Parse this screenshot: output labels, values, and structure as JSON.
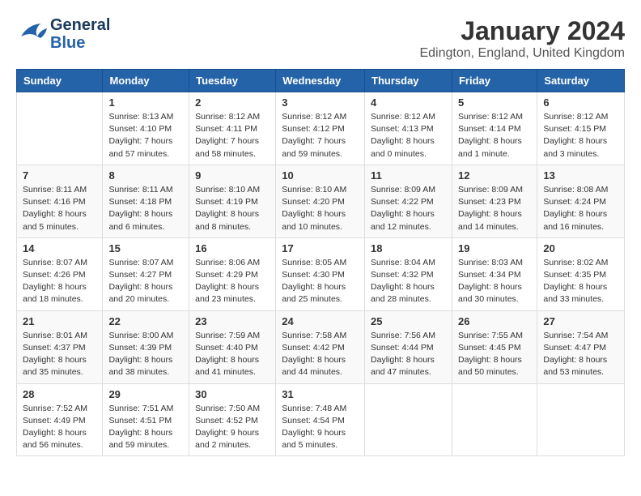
{
  "header": {
    "logo_general": "General",
    "logo_blue": "Blue",
    "month_title": "January 2024",
    "location": "Edington, England, United Kingdom"
  },
  "days_of_week": [
    "Sunday",
    "Monday",
    "Tuesday",
    "Wednesday",
    "Thursday",
    "Friday",
    "Saturday"
  ],
  "weeks": [
    [
      {
        "day": "",
        "info": ""
      },
      {
        "day": "1",
        "info": "Sunrise: 8:13 AM\nSunset: 4:10 PM\nDaylight: 7 hours\nand 57 minutes."
      },
      {
        "day": "2",
        "info": "Sunrise: 8:12 AM\nSunset: 4:11 PM\nDaylight: 7 hours\nand 58 minutes."
      },
      {
        "day": "3",
        "info": "Sunrise: 8:12 AM\nSunset: 4:12 PM\nDaylight: 7 hours\nand 59 minutes."
      },
      {
        "day": "4",
        "info": "Sunrise: 8:12 AM\nSunset: 4:13 PM\nDaylight: 8 hours\nand 0 minutes."
      },
      {
        "day": "5",
        "info": "Sunrise: 8:12 AM\nSunset: 4:14 PM\nDaylight: 8 hours\nand 1 minute."
      },
      {
        "day": "6",
        "info": "Sunrise: 8:12 AM\nSunset: 4:15 PM\nDaylight: 8 hours\nand 3 minutes."
      }
    ],
    [
      {
        "day": "7",
        "info": "Sunrise: 8:11 AM\nSunset: 4:16 PM\nDaylight: 8 hours\nand 5 minutes."
      },
      {
        "day": "8",
        "info": "Sunrise: 8:11 AM\nSunset: 4:18 PM\nDaylight: 8 hours\nand 6 minutes."
      },
      {
        "day": "9",
        "info": "Sunrise: 8:10 AM\nSunset: 4:19 PM\nDaylight: 8 hours\nand 8 minutes."
      },
      {
        "day": "10",
        "info": "Sunrise: 8:10 AM\nSunset: 4:20 PM\nDaylight: 8 hours\nand 10 minutes."
      },
      {
        "day": "11",
        "info": "Sunrise: 8:09 AM\nSunset: 4:22 PM\nDaylight: 8 hours\nand 12 minutes."
      },
      {
        "day": "12",
        "info": "Sunrise: 8:09 AM\nSunset: 4:23 PM\nDaylight: 8 hours\nand 14 minutes."
      },
      {
        "day": "13",
        "info": "Sunrise: 8:08 AM\nSunset: 4:24 PM\nDaylight: 8 hours\nand 16 minutes."
      }
    ],
    [
      {
        "day": "14",
        "info": "Sunrise: 8:07 AM\nSunset: 4:26 PM\nDaylight: 8 hours\nand 18 minutes."
      },
      {
        "day": "15",
        "info": "Sunrise: 8:07 AM\nSunset: 4:27 PM\nDaylight: 8 hours\nand 20 minutes."
      },
      {
        "day": "16",
        "info": "Sunrise: 8:06 AM\nSunset: 4:29 PM\nDaylight: 8 hours\nand 23 minutes."
      },
      {
        "day": "17",
        "info": "Sunrise: 8:05 AM\nSunset: 4:30 PM\nDaylight: 8 hours\nand 25 minutes."
      },
      {
        "day": "18",
        "info": "Sunrise: 8:04 AM\nSunset: 4:32 PM\nDaylight: 8 hours\nand 28 minutes."
      },
      {
        "day": "19",
        "info": "Sunrise: 8:03 AM\nSunset: 4:34 PM\nDaylight: 8 hours\nand 30 minutes."
      },
      {
        "day": "20",
        "info": "Sunrise: 8:02 AM\nSunset: 4:35 PM\nDaylight: 8 hours\nand 33 minutes."
      }
    ],
    [
      {
        "day": "21",
        "info": "Sunrise: 8:01 AM\nSunset: 4:37 PM\nDaylight: 8 hours\nand 35 minutes."
      },
      {
        "day": "22",
        "info": "Sunrise: 8:00 AM\nSunset: 4:39 PM\nDaylight: 8 hours\nand 38 minutes."
      },
      {
        "day": "23",
        "info": "Sunrise: 7:59 AM\nSunset: 4:40 PM\nDaylight: 8 hours\nand 41 minutes."
      },
      {
        "day": "24",
        "info": "Sunrise: 7:58 AM\nSunset: 4:42 PM\nDaylight: 8 hours\nand 44 minutes."
      },
      {
        "day": "25",
        "info": "Sunrise: 7:56 AM\nSunset: 4:44 PM\nDaylight: 8 hours\nand 47 minutes."
      },
      {
        "day": "26",
        "info": "Sunrise: 7:55 AM\nSunset: 4:45 PM\nDaylight: 8 hours\nand 50 minutes."
      },
      {
        "day": "27",
        "info": "Sunrise: 7:54 AM\nSunset: 4:47 PM\nDaylight: 8 hours\nand 53 minutes."
      }
    ],
    [
      {
        "day": "28",
        "info": "Sunrise: 7:52 AM\nSunset: 4:49 PM\nDaylight: 8 hours\nand 56 minutes."
      },
      {
        "day": "29",
        "info": "Sunrise: 7:51 AM\nSunset: 4:51 PM\nDaylight: 8 hours\nand 59 minutes."
      },
      {
        "day": "30",
        "info": "Sunrise: 7:50 AM\nSunset: 4:52 PM\nDaylight: 9 hours\nand 2 minutes."
      },
      {
        "day": "31",
        "info": "Sunrise: 7:48 AM\nSunset: 4:54 PM\nDaylight: 9 hours\nand 5 minutes."
      },
      {
        "day": "",
        "info": ""
      },
      {
        "day": "",
        "info": ""
      },
      {
        "day": "",
        "info": ""
      }
    ]
  ]
}
